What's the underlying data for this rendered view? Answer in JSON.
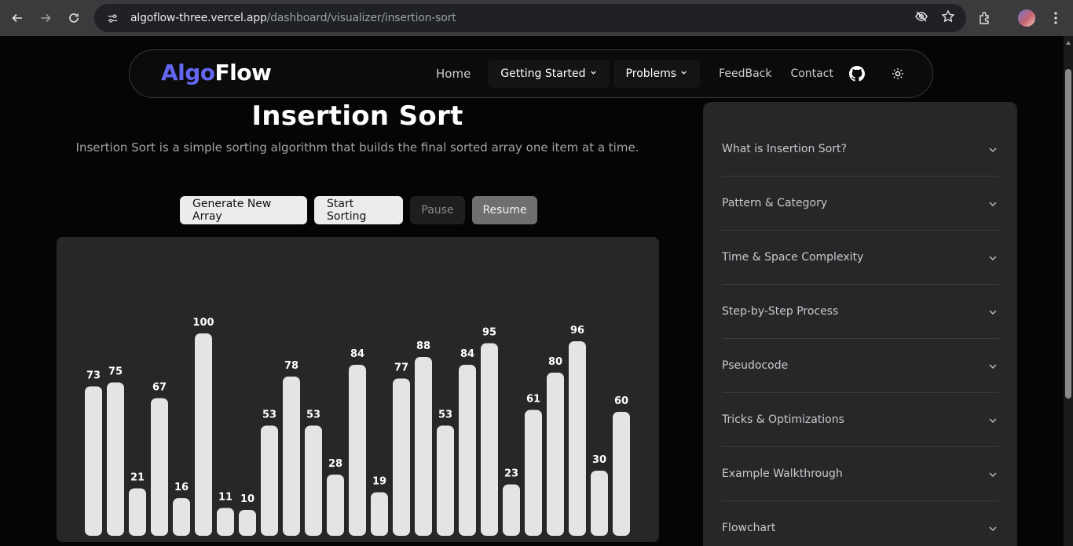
{
  "browser": {
    "url_host": "algoflow-three.vercel.app",
    "url_path": "/dashboard/visualizer/insertion-sort"
  },
  "navbar": {
    "logo_part1": "Algo",
    "logo_part2": "Flow",
    "home": "Home",
    "getting_started": "Getting Started",
    "problems": "Problems",
    "feedback": "FeedBack",
    "contact": "Contact"
  },
  "main": {
    "title": "Insertion Sort",
    "subtitle": "Insertion Sort is a simple sorting algorithm that builds the final sorted array one item at a time."
  },
  "controls": {
    "generate": "Generate New Array",
    "start": "Start Sorting",
    "pause": "Pause",
    "resume": "Resume"
  },
  "sidebar": {
    "items": [
      {
        "label": "What is Insertion Sort?"
      },
      {
        "label": "Pattern & Category"
      },
      {
        "label": "Time & Space Complexity"
      },
      {
        "label": "Step-by-Step Process"
      },
      {
        "label": "Pseudocode"
      },
      {
        "label": "Tricks & Optimizations"
      },
      {
        "label": "Example Walkthrough"
      },
      {
        "label": "Flowchart"
      }
    ]
  },
  "chart_data": {
    "type": "bar",
    "values": [
      73,
      75,
      21,
      67,
      16,
      100,
      11,
      10,
      53,
      78,
      53,
      28,
      84,
      19,
      77,
      88,
      53,
      84,
      95,
      23,
      61,
      80,
      96,
      30,
      60
    ],
    "bar_color": "#e4e4e7",
    "label_color": "#ffffff"
  },
  "colors": {
    "accent": "#6366f1",
    "panel": "#27272a"
  }
}
